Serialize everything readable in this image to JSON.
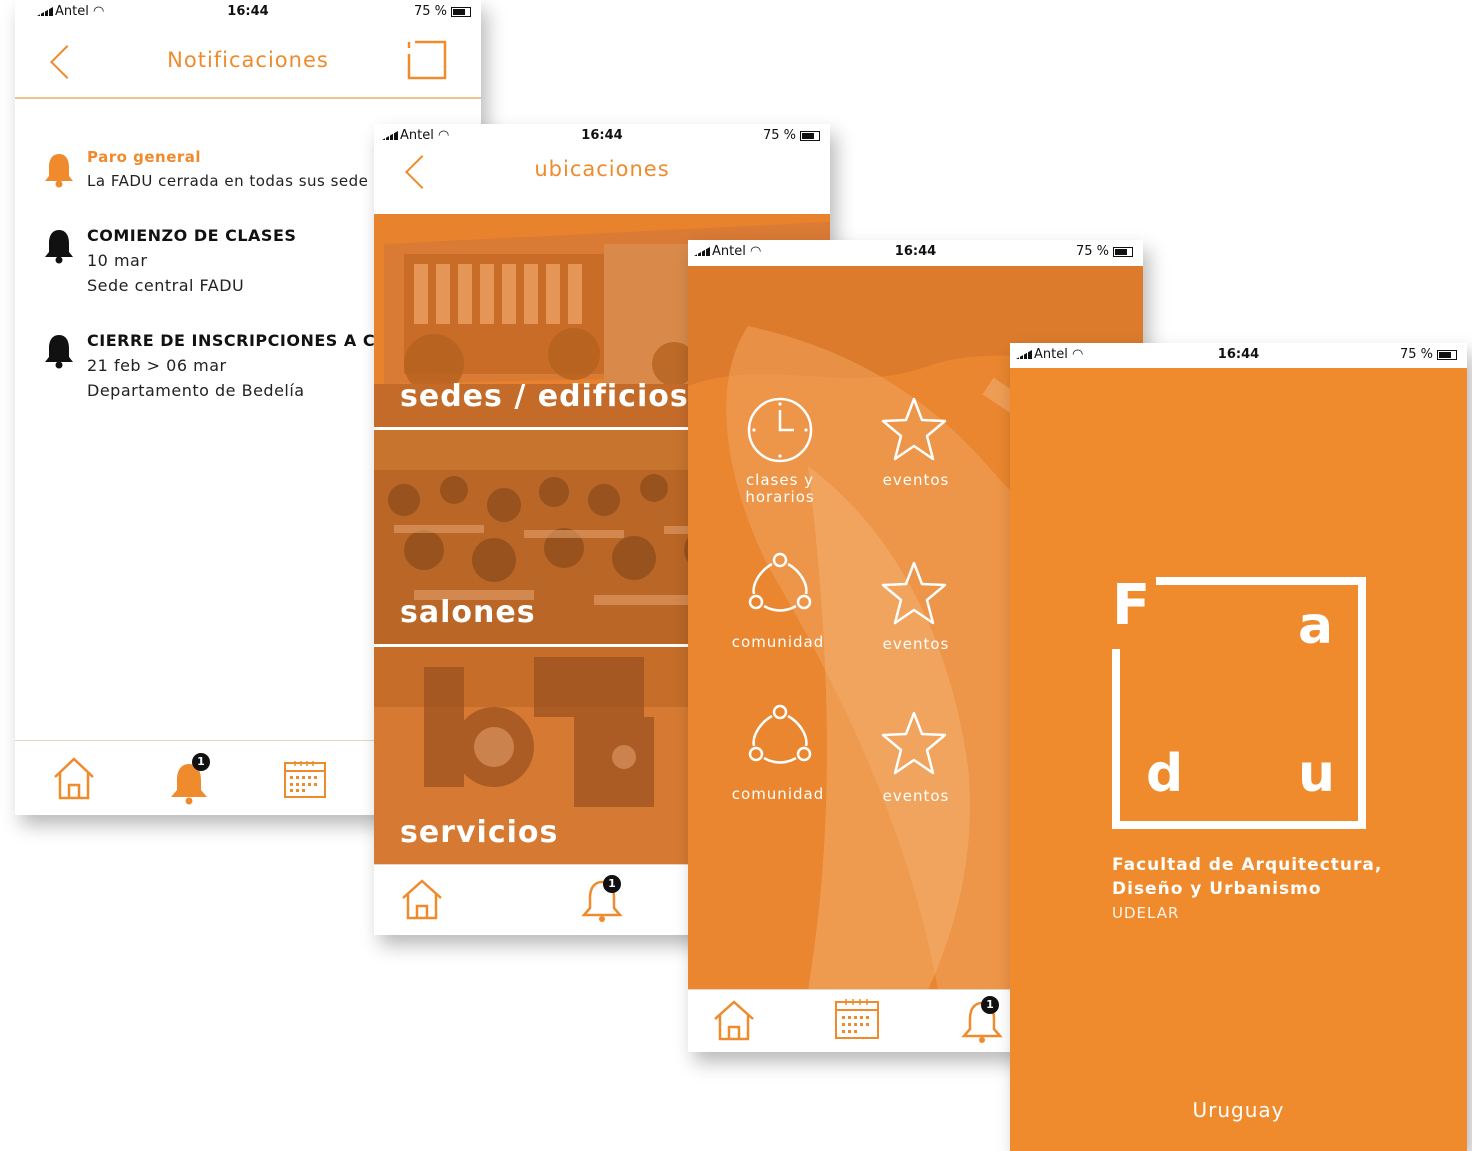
{
  "status": {
    "carrier": "Antel",
    "time": "16:44",
    "battery": "75 %"
  },
  "colors": {
    "accent": "#ef8b2c",
    "tile_overlay": "#e9822c",
    "text": "#111111"
  },
  "notifications_screen": {
    "title": "Notificaciones",
    "items": [
      {
        "title": "Paro general",
        "lines": [
          "La FADU cerrada en todas sus sede"
        ],
        "icon": "bell-icon",
        "highlight": true
      },
      {
        "title": "COMIENZO DE CLASES",
        "lines": [
          "10 mar",
          "Sede central FADU"
        ],
        "icon": "bell-icon",
        "highlight": false
      },
      {
        "title": "CIERRE DE INSCRIPCIONES A CUR",
        "lines": [
          "21 feb > 06 mar",
          "Departamento de Bedelía"
        ],
        "icon": "bell-icon",
        "highlight": false
      }
    ],
    "tabs": [
      "home-icon",
      "bell-icon",
      "calendar-icon"
    ],
    "badge": "1"
  },
  "locations_screen": {
    "title": "ubicaciones",
    "tiles": [
      "sedes / edificios",
      "salones",
      "servicios"
    ],
    "tabs": [
      "home-icon",
      "bell-icon"
    ],
    "badge": "1"
  },
  "menu_screen": {
    "items": [
      {
        "label": "clases y horarios",
        "icon": "clock-icon"
      },
      {
        "label": "eventos",
        "icon": "star-icon"
      },
      {
        "label": "comunidad",
        "icon": "community-icon"
      },
      {
        "label": "eventos",
        "icon": "star-icon"
      },
      {
        "label": "comunidad",
        "icon": "community-icon"
      },
      {
        "label": "eventos",
        "icon": "star-icon"
      }
    ],
    "tabs": [
      "home-icon",
      "calendar-icon",
      "bell-icon"
    ],
    "badge": "1"
  },
  "splash_screen": {
    "logo_letters": [
      "F",
      "a",
      "d",
      "u"
    ],
    "institution_line1": "Facultad de Arquitectura,",
    "institution_line2": "Diseño y Urbanismo",
    "university": "UDELAR",
    "country": "Uruguay"
  }
}
